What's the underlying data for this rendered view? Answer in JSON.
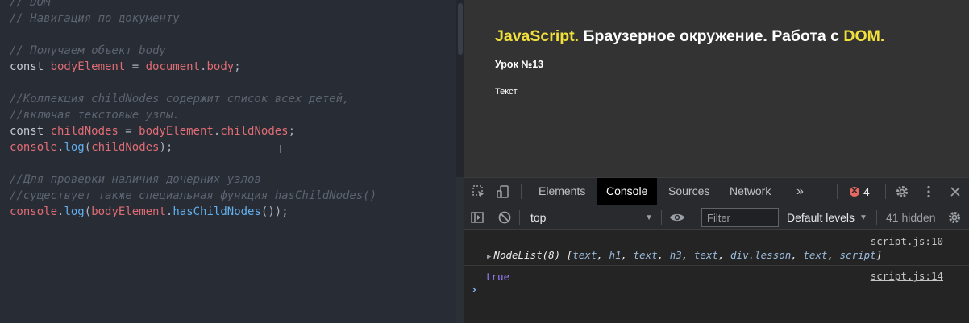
{
  "editor": {
    "lines": [
      [
        {
          "t": "// DOM",
          "c": "cm"
        }
      ],
      [
        {
          "t": "// Навигация по документу",
          "c": "cm"
        }
      ],
      [
        {
          "t": "",
          "c": "pl"
        }
      ],
      [
        {
          "t": "// Получаем объект body",
          "c": "cm"
        }
      ],
      [
        {
          "t": "const ",
          "c": "kw"
        },
        {
          "t": "bodyElement",
          "c": "vr"
        },
        {
          "t": " = ",
          "c": "pl"
        },
        {
          "t": "document",
          "c": "vr"
        },
        {
          "t": ".",
          "c": "pl"
        },
        {
          "t": "body",
          "c": "vr"
        },
        {
          "t": ";",
          "c": "pl"
        }
      ],
      [
        {
          "t": "",
          "c": "pl"
        }
      ],
      [
        {
          "t": "//Коллекция childNodes содержит список всех детей,",
          "c": "cm"
        }
      ],
      [
        {
          "t": "//включая текстовые узлы.",
          "c": "cm"
        }
      ],
      [
        {
          "t": "const ",
          "c": "kw"
        },
        {
          "t": "childNodes",
          "c": "vr"
        },
        {
          "t": " = ",
          "c": "pl"
        },
        {
          "t": "bodyElement",
          "c": "vr"
        },
        {
          "t": ".",
          "c": "pl"
        },
        {
          "t": "childNodes",
          "c": "vr"
        },
        {
          "t": ";",
          "c": "pl"
        }
      ],
      [
        {
          "t": "console",
          "c": "vr"
        },
        {
          "t": ".",
          "c": "pl"
        },
        {
          "t": "log",
          "c": "fn"
        },
        {
          "t": "(",
          "c": "pl"
        },
        {
          "t": "childNodes",
          "c": "vr"
        },
        {
          "t": ");",
          "c": "pl"
        }
      ],
      [
        {
          "t": "",
          "c": "pl"
        }
      ],
      [
        {
          "t": "//Для проверки наличия дочерних узлов",
          "c": "cm"
        }
      ],
      [
        {
          "t": "//существует также специальная функция hasChildNodes()",
          "c": "cm"
        }
      ],
      [
        {
          "t": "console",
          "c": "vr"
        },
        {
          "t": ".",
          "c": "pl"
        },
        {
          "t": "log",
          "c": "fn"
        },
        {
          "t": "(",
          "c": "pl"
        },
        {
          "t": "bodyElement",
          "c": "vr"
        },
        {
          "t": ".",
          "c": "pl"
        },
        {
          "t": "hasChildNodes",
          "c": "fn"
        },
        {
          "t": "());",
          "c": "pl"
        }
      ]
    ]
  },
  "preview": {
    "title_js": "JavaScript.",
    "title_mid": " Браузерное окружение. Работа с ",
    "title_dom": "DOM.",
    "subtitle": "Урок №13",
    "text": "Текст"
  },
  "devtools": {
    "tabs": [
      "Elements",
      "Console",
      "Sources",
      "Network"
    ],
    "more": "»",
    "error_count": "4",
    "error_mark": "✕",
    "context": "top",
    "filter_placeholder": "Filter",
    "levels": "Default levels",
    "hidden": "41 hidden",
    "console": {
      "msg1_source": "script.js:10",
      "nodelist_label": "NodeList(8) [",
      "nodelist_items": [
        "text",
        "h1",
        "text",
        "h3",
        "text",
        "div.lesson",
        "text",
        "script"
      ],
      "nodelist_close": "]",
      "msg2_source": "script.js:14",
      "msg2_value": "true",
      "prompt": "›"
    }
  },
  "colors": {
    "highlight": "#f1e03b",
    "comment": "#5c6370",
    "variable": "#e06c75",
    "console_true": "#9980ff"
  }
}
